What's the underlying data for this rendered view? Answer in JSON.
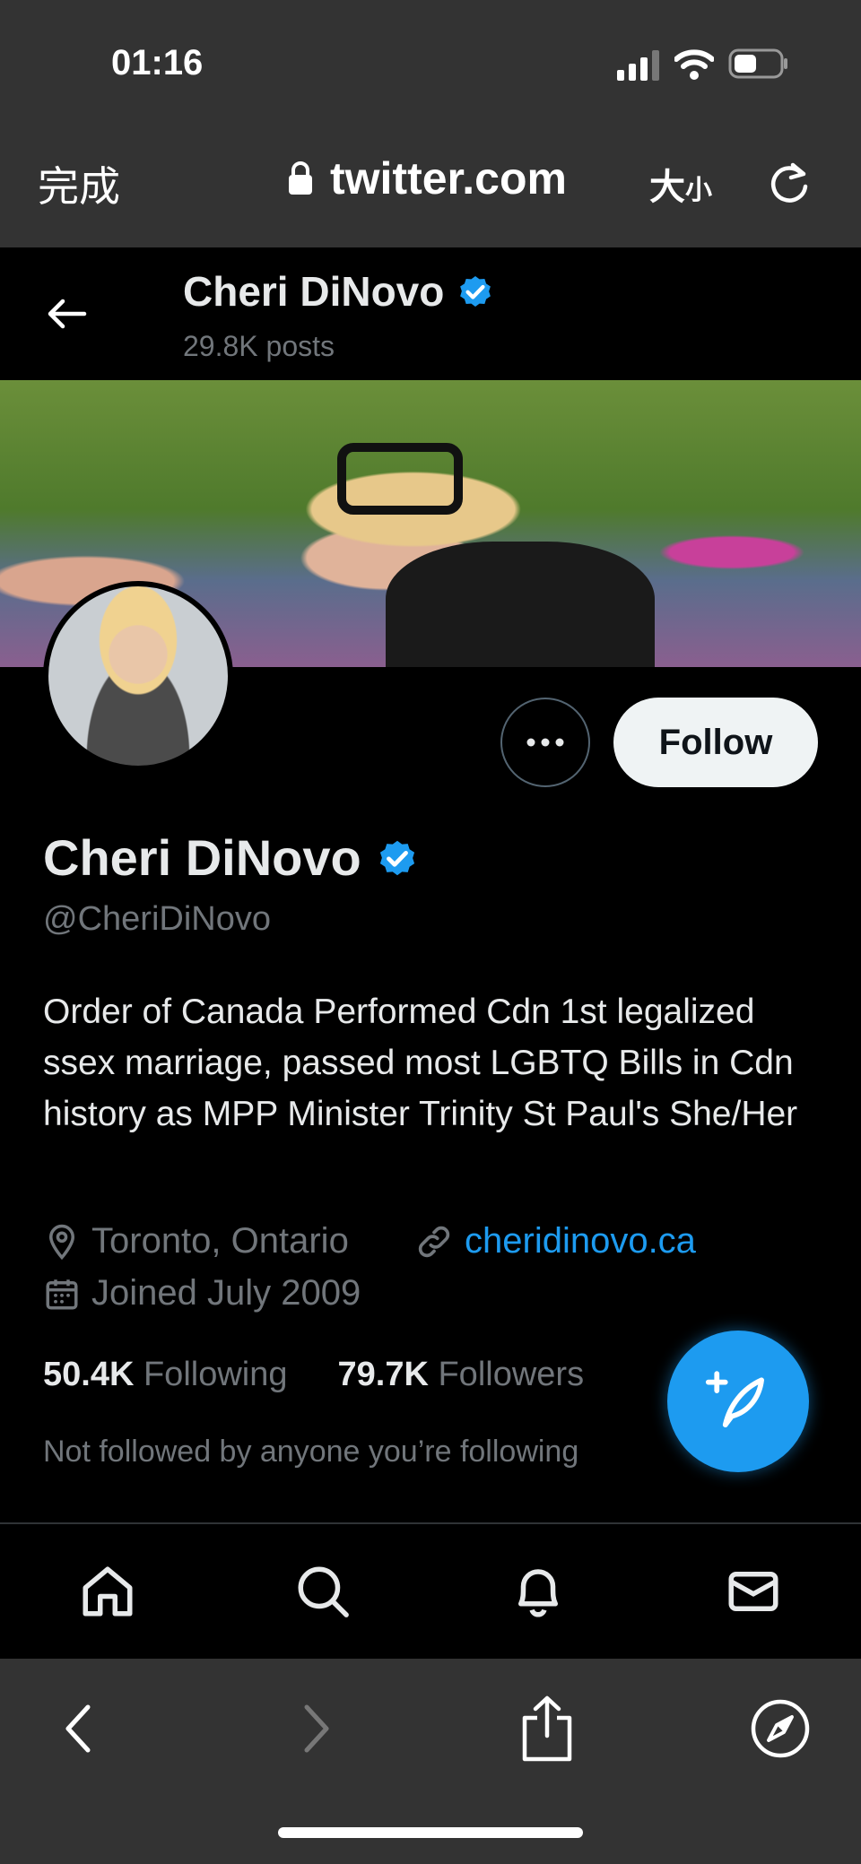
{
  "status_bar": {
    "time": "01:16"
  },
  "safari": {
    "done_label": "完成",
    "url": "twitter.com",
    "text_size_big": "大",
    "text_size_small": "小"
  },
  "header": {
    "name": "Cheri DiNovo",
    "posts": "29.8K posts"
  },
  "profile": {
    "display_name": "Cheri DiNovo",
    "handle": "@CheriDiNovo",
    "follow_label": "Follow",
    "bio": "Order of Canada Performed Cdn 1st legalized ssex marriage, passed most LGBTQ Bills in Cdn history as MPP Minister Trinity St Paul's She/Her",
    "location": "Toronto, Ontario",
    "website": "cheridinovo.ca",
    "joined": "Joined July 2009",
    "following_count": "50.4K",
    "following_label": "Following",
    "followers_count": "79.7K",
    "followers_label": "Followers",
    "not_followed": "Not followed by anyone you’re following"
  },
  "colors": {
    "accent": "#1d9bf0",
    "background": "#000000",
    "muted": "#71767b",
    "safari_chrome": "#333333"
  },
  "icons": [
    "back-arrow-icon",
    "verified-badge-icon",
    "more-icon",
    "location-icon",
    "link-icon",
    "calendar-icon",
    "compose-icon",
    "home-icon",
    "search-icon",
    "notifications-icon",
    "messages-icon",
    "safari-back-icon",
    "safari-forward-icon",
    "share-icon",
    "compass-icon",
    "lock-icon",
    "reload-icon",
    "signal-icon",
    "wifi-icon",
    "battery-icon"
  ]
}
